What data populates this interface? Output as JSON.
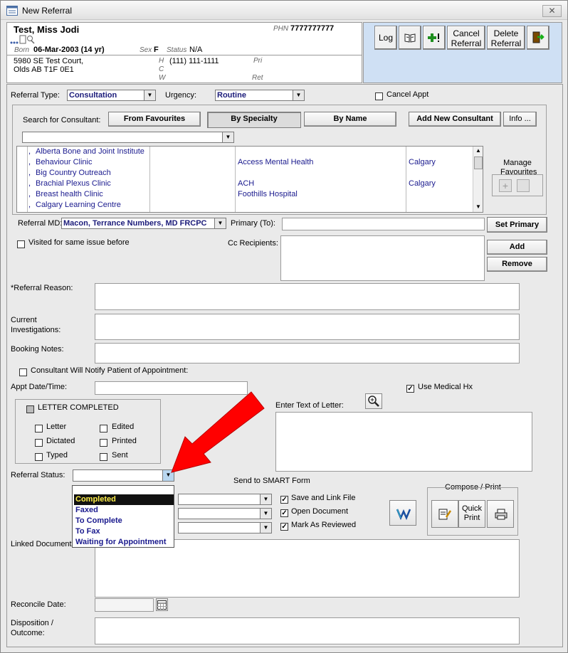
{
  "window": {
    "title": "New Referral",
    "close": "✕"
  },
  "patient": {
    "name": "Test, Miss Jodi",
    "phn_label": "PHN",
    "phn": "7777777777",
    "born_label": "Born",
    "born": "06-Mar-2003 (14 yr)",
    "sex_label": "Sex",
    "sex": "F",
    "status_label": "Status",
    "status": "N/A",
    "address1": "5980 SE Test Court,",
    "address2": "Olds AB  T1F 0E1",
    "phone_h_label": "H",
    "phone_h": "(111) 111-1111",
    "phone_c_label": "C",
    "phone_w_label": "W",
    "pri_label": "Pri",
    "ret_label": "Ret"
  },
  "toolbar": {
    "log": "Log",
    "cancel_referral": "Cancel Referral",
    "delete_referral": "Delete Referral"
  },
  "form": {
    "referral_type_label": "Referral Type:",
    "referral_type": "Consultation",
    "urgency_label": "Urgency:",
    "urgency": "Routine",
    "cancel_appt": "Cancel Appt",
    "search_label": "Search for Consultant:",
    "from_favourites": "From Favourites",
    "by_specialty": "By Specialty",
    "by_name": "By Name",
    "add_new_consultant": "Add New Consultant",
    "info": "Info ...",
    "manage_favourites": "Manage Favourites",
    "consultants": [
      {
        "name": "Alberta Bone and Joint Institute",
        "org": "",
        "city": ""
      },
      {
        "name": "Behaviour Clinic",
        "org": "Access Mental Health",
        "city": "Calgary"
      },
      {
        "name": "Big Country Outreach",
        "org": "",
        "city": ""
      },
      {
        "name": "Brachial Plexus Clinic",
        "org": "ACH",
        "city": "Calgary"
      },
      {
        "name": "Breast health Clinic",
        "org": "Foothills Hospital",
        "city": ""
      },
      {
        "name": "Calgary Learning Centre",
        "org": "",
        "city": ""
      }
    ],
    "referral_md_label": "Referral MD:",
    "referral_md": "Macon, Terrance Numbers, MD FRCPC",
    "primary_to_label": "Primary (To):",
    "set_primary": "Set Primary",
    "visited_same_issue": "Visited for same issue before",
    "cc_recipients_label": "Cc Recipients:",
    "add": "Add",
    "remove": "Remove",
    "referral_reason_label": "*Referral Reason:",
    "current_investigations_label": "Current Investigations:",
    "booking_notes_label": "Booking Notes:",
    "consultant_notify": "Consultant Will Notify Patient of Appointment:",
    "appt_datetime_label": "Appt Date/Time:",
    "use_medical_hx": "Use Medical Hx",
    "letter_completed": "LETTER COMPLETED",
    "letter": "Letter",
    "edited": "Edited",
    "dictated": "Dictated",
    "printed": "Printed",
    "typed": "Typed",
    "sent": "Sent",
    "enter_text_letter": "Enter Text of Letter:",
    "referral_status_label": "Referral Status:",
    "referral_status": "",
    "status_options": [
      "Completed",
      "Faxed",
      "To Complete",
      "To Fax",
      "Waiting for Appointment"
    ],
    "send_to_smart_form": "Send to SMART Form",
    "save_and_link": "Save and Link File",
    "open_document": "Open Document",
    "mark_as_reviewed": "Mark As Reviewed",
    "compose_print": "Compose / Print",
    "quick_print": "Quick Print",
    "linked_documents_label": "Linked Documents:",
    "reconcile_date_label": "Reconcile Date:",
    "disposition_label": "Disposition / Outcome:"
  },
  "colors": {
    "arrow": "#ff0000",
    "toolbar_bg": "#cfe0f4",
    "list_text": "#1a1a8e"
  }
}
